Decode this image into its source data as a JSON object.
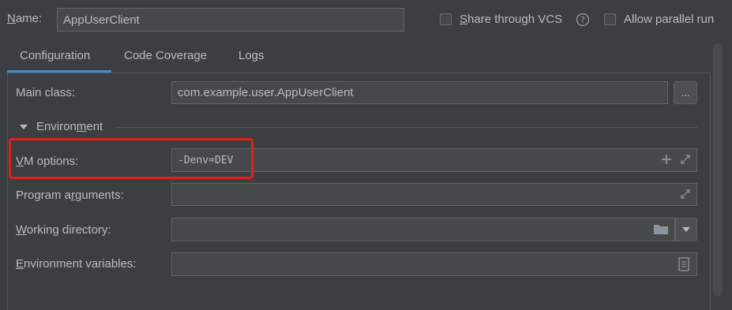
{
  "header": {
    "name_label": "Name:",
    "name_value": "AppUserClient",
    "share_label": "Share through VCS",
    "share_help": "?",
    "parallel_label": "Allow parallel run"
  },
  "tabs": [
    {
      "label": "Configuration",
      "active": true
    },
    {
      "label": "Code Coverage",
      "active": false
    },
    {
      "label": "Logs",
      "active": false
    }
  ],
  "form": {
    "main_class_label": "Main class:",
    "main_class_value": "com.example.user.AppUserClient",
    "main_class_browse": "...",
    "environment_label": "Environment",
    "vm_options_label": "VM options:",
    "vm_options_value": "-Denv=DEV",
    "program_args_label": "Program arguments:",
    "working_dir_label": "Working directory:",
    "env_vars_label": "Environment variables:"
  },
  "colors": {
    "background": "#3c3f41",
    "tab_underline": "#4a88c7",
    "highlight_box": "#e0201b",
    "text": "#bbbbbb"
  },
  "icons": [
    "help-icon",
    "expand-icon",
    "add-icon",
    "folder-icon",
    "dropdown-arrow-icon",
    "document-icon",
    "triangle-down-icon"
  ]
}
